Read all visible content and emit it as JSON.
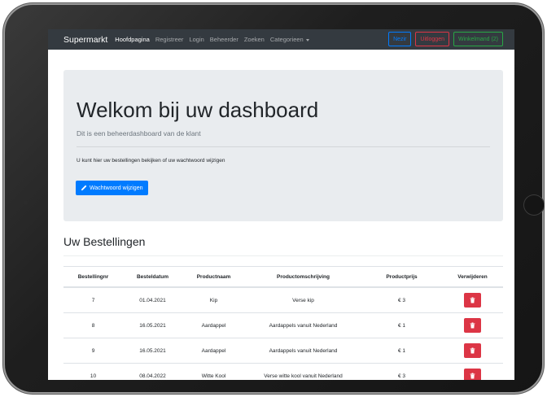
{
  "navbar": {
    "brand": "Supermarkt",
    "links": [
      "Hoofdpagina",
      "Registreer",
      "Login",
      "Beheerder",
      "Zoeken",
      "Categorieen"
    ],
    "buttons": {
      "nezir": "Nezir",
      "logout": "Uitloggen",
      "cart": "Winkelmand (2)"
    }
  },
  "jumbotron": {
    "title": "Welkom bij uw dashboard",
    "lead": "Dit is een beheerdashboard van de klant",
    "text": "U kunt hier uw bestellingen bekijken of uw wachtwoord wijzigen",
    "button": "Wachtwoord wijzigen"
  },
  "orders": {
    "heading": "Uw Bestellingen",
    "columns": [
      "Bestellingnr",
      "Besteldatum",
      "Productnaam",
      "Productomschrijving",
      "Productprijs",
      "Verwijderen"
    ],
    "rows": [
      {
        "nr": "7",
        "date": "01.04.2021",
        "name": "Kip",
        "desc": "Verse kip",
        "price": "€ 3"
      },
      {
        "nr": "8",
        "date": "16.05.2021",
        "name": "Aardappel",
        "desc": "Aardappels vanuit Nederland",
        "price": "€ 1"
      },
      {
        "nr": "9",
        "date": "16.05.2021",
        "name": "Aardappel",
        "desc": "Aardappels vanuit Nederland",
        "price": "€ 1"
      },
      {
        "nr": "10",
        "date": "08.04.2022",
        "name": "Witte Kool",
        "desc": "Verse witte kool vanuit Nederland",
        "price": "€ 3"
      }
    ]
  },
  "icons": {
    "edit": "pencil-icon",
    "delete": "trash-icon",
    "dropdown": "caret-down-icon"
  },
  "colors": {
    "primary": "#007bff",
    "danger": "#dc3545",
    "success": "#28a745",
    "navbar": "#343a40",
    "jumbotron": "#e9ecef"
  }
}
